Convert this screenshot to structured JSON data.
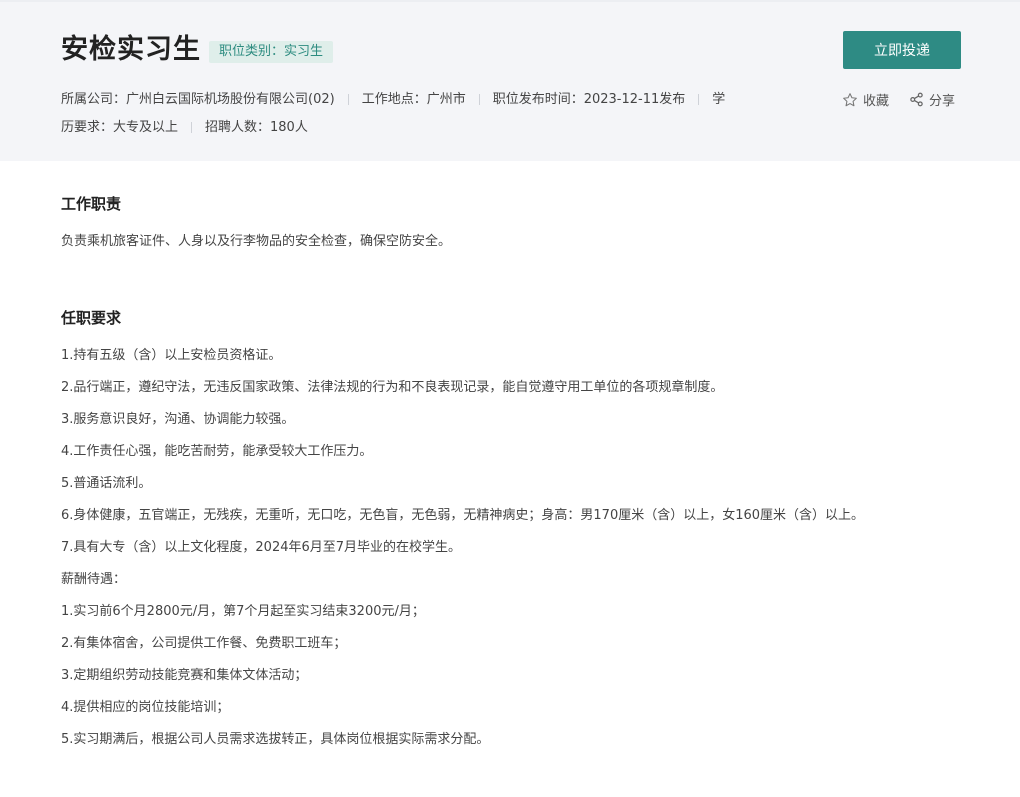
{
  "header": {
    "job_title": "安检实习生",
    "category_tag": "职位类别：实习生",
    "meta": {
      "company": "所属公司：广州白云国际机场股份有限公司(02)",
      "location": "工作地点：广州市",
      "publish_time": "职位发布时间：2023-12-11发布",
      "education": "学历要求：大专及以上",
      "headcount": "招聘人数：180人"
    },
    "apply_button": "立即投递",
    "favorite_label": "收藏",
    "share_label": "分享"
  },
  "duties": {
    "title": "工作职责",
    "text": "负责乘机旅客证件、人身以及行李物品的安全检查，确保空防安全。"
  },
  "requirements": {
    "title": "任职要求",
    "lines": [
      "1.持有五级（含）以上安检员资格证。",
      "2.品行端正，遵纪守法，无违反国家政策、法律法规的行为和不良表现记录，能自觉遵守用工单位的各项规章制度。",
      "3.服务意识良好，沟通、协调能力较强。",
      "4.工作责任心强，能吃苦耐劳，能承受较大工作压力。",
      "5.普通话流利。",
      "6.身体健康，五官端正，无残疾，无重听，无口吃，无色盲，无色弱，无精神病史；身高：男170厘米（含）以上，女160厘米（含）以上。",
      "7.具有大专（含）以上文化程度，2024年6月至7月毕业的在校学生。",
      "薪酬待遇：",
      "1.实习前6个月2800元/月，第7个月起至实习结束3200元/月；",
      "2.有集体宿舍，公司提供工作餐、免费职工班车；",
      "3.定期组织劳动技能竞赛和集体文体活动；",
      "4.提供相应的岗位技能培训；",
      "5.实习期满后，根据公司人员需求选拔转正，具体岗位根据实际需求分配。"
    ]
  },
  "colors": {
    "accent": "#2e8b84",
    "tag_background": "#dfeeea",
    "header_background": "#f4f5f8"
  },
  "icons": {
    "favorite": "star-outline-icon",
    "share": "share-icon"
  }
}
